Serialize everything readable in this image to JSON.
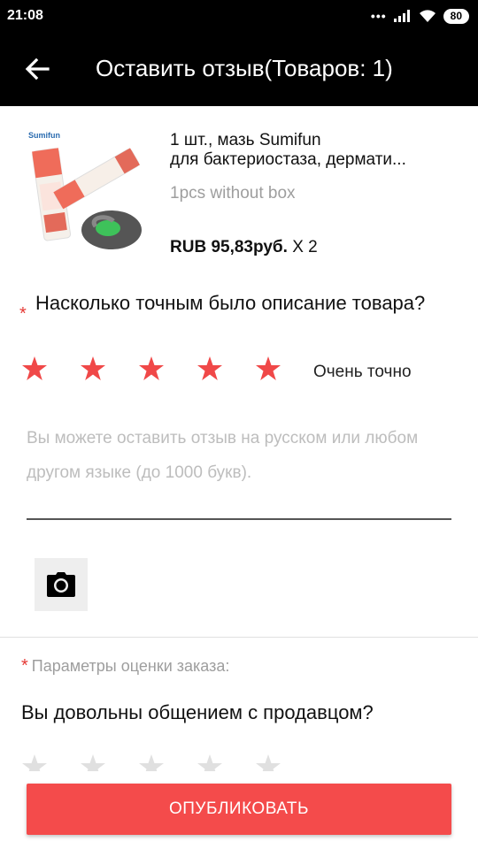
{
  "status_bar": {
    "time": "21:08",
    "battery": "80",
    "icons": [
      "dots-icon",
      "signal-icon",
      "wifi-icon",
      "battery-icon"
    ]
  },
  "app_bar": {
    "back_icon": "arrow-left-icon",
    "title": "Оставить отзыв(Товаров: 1)"
  },
  "product": {
    "image_brand": "Sumifun",
    "name_line1": "1 шт., мазь Sumifun",
    "name_line2": "для бактериостаза, дермати...",
    "variant": "1pcs without box",
    "price": "RUB 95,83руб.",
    "quantity": "X 2"
  },
  "question1": {
    "required_mark": "*",
    "text": "Насколько точным было описание товара?",
    "rating": 5,
    "rating_max": 5,
    "rating_label": "Очень точно",
    "star_color": "#f04848"
  },
  "review": {
    "placeholder": "Вы можете оставить отзыв на русском или любом другом языке (до 1000 букв).",
    "value": ""
  },
  "photo": {
    "icon": "camera-icon"
  },
  "order_params": {
    "required_mark": "*",
    "label": "Параметры оценки заказа:",
    "question": "Вы довольны общением с продавцом?",
    "rating": 0,
    "rating_max": 5
  },
  "publish": {
    "label": "ОПУБЛИКОВАТЬ",
    "color": "#f44b4b"
  }
}
